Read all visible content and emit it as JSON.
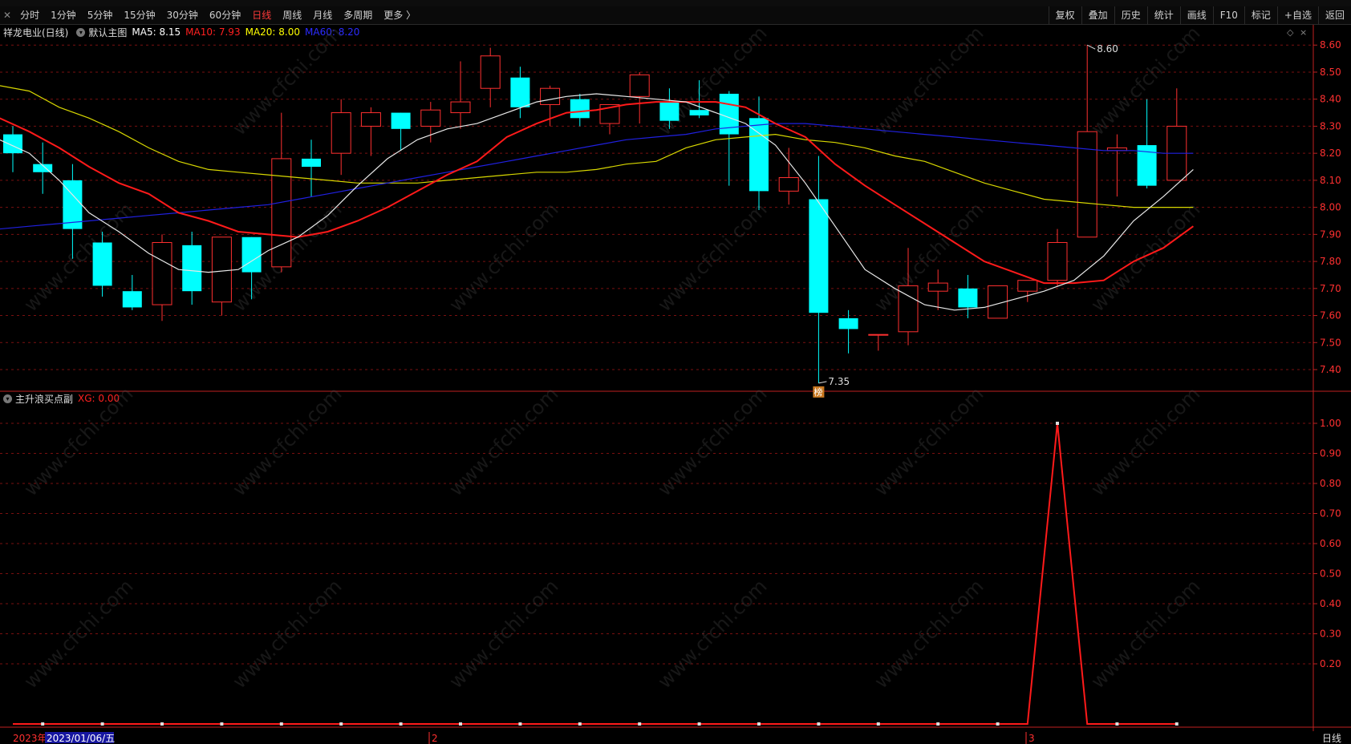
{
  "toolbar": {
    "periods": [
      "分时",
      "1分钟",
      "5分钟",
      "15分钟",
      "30分钟",
      "60分钟",
      "日线",
      "周线",
      "月线",
      "多周期",
      "更多 〉"
    ],
    "active_period": "日线",
    "right_buttons": [
      "复权",
      "叠加",
      "历史",
      "统计",
      "画线",
      "F10",
      "标记",
      "+自选",
      "返回"
    ]
  },
  "main_panel": {
    "stock": "祥龙电业(日线)",
    "template": "默认主图",
    "ma": [
      {
        "label": "MA5: 8.15",
        "color": "#ffffff"
      },
      {
        "label": "MA10: 7.93",
        "color": "#ff2020"
      },
      {
        "label": "MA20: 8.00",
        "color": "#ffff00"
      },
      {
        "label": "MA60: 8.20",
        "color": "#2b2bff"
      }
    ],
    "y_ticks": [
      "8.60",
      "8.50",
      "8.40",
      "8.30",
      "8.20",
      "8.10",
      "8.00",
      "7.90",
      "7.80",
      "7.70",
      "7.60",
      "7.50",
      "7.40"
    ],
    "high_label": "8.60",
    "low_label": "7.35",
    "badge": "榜"
  },
  "sub_panel": {
    "indicator": "主升浪买点副",
    "xg_label": "XG: 0.00",
    "y_ticks": [
      "1.00",
      "0.90",
      "0.80",
      "0.70",
      "0.60",
      "0.50",
      "0.40",
      "0.30",
      "0.20"
    ]
  },
  "bottom": {
    "year": "2023年",
    "date": "2023/01/06/五",
    "month_marks": [
      "2",
      "3"
    ],
    "period_label": "日线"
  },
  "watermark": "www.cfchi.com",
  "colors": {
    "up": "#ff3030",
    "down": "#00ffff",
    "grid": "#7a1010",
    "axis": "#c02020"
  },
  "chart_data": {
    "type": "candlestick",
    "candles": [
      {
        "o": 8.27,
        "h": 8.3,
        "l": 8.13,
        "c": 8.2
      },
      {
        "o": 8.16,
        "h": 8.24,
        "l": 8.05,
        "c": 8.13
      },
      {
        "o": 8.1,
        "h": 8.16,
        "l": 7.81,
        "c": 7.92
      },
      {
        "o": 7.87,
        "h": 7.91,
        "l": 7.67,
        "c": 7.71
      },
      {
        "o": 7.69,
        "h": 7.75,
        "l": 7.62,
        "c": 7.63
      },
      {
        "o": 7.64,
        "h": 7.9,
        "l": 7.58,
        "c": 7.87
      },
      {
        "o": 7.86,
        "h": 7.91,
        "l": 7.64,
        "c": 7.69
      },
      {
        "o": 7.65,
        "h": 7.89,
        "l": 7.6,
        "c": 7.89
      },
      {
        "o": 7.89,
        "h": 7.89,
        "l": 7.66,
        "c": 7.76
      },
      {
        "o": 7.78,
        "h": 8.35,
        "l": 7.76,
        "c": 8.18
      },
      {
        "o": 8.18,
        "h": 8.25,
        "l": 8.04,
        "c": 8.15
      },
      {
        "o": 8.2,
        "h": 8.4,
        "l": 8.12,
        "c": 8.35
      },
      {
        "o": 8.3,
        "h": 8.37,
        "l": 8.19,
        "c": 8.35
      },
      {
        "o": 8.35,
        "h": 8.35,
        "l": 8.21,
        "c": 8.29
      },
      {
        "o": 8.3,
        "h": 8.39,
        "l": 8.24,
        "c": 8.36
      },
      {
        "o": 8.35,
        "h": 8.54,
        "l": 8.29,
        "c": 8.39
      },
      {
        "o": 8.44,
        "h": 8.59,
        "l": 8.37,
        "c": 8.56
      },
      {
        "o": 8.48,
        "h": 8.52,
        "l": 8.33,
        "c": 8.37
      },
      {
        "o": 8.38,
        "h": 8.45,
        "l": 8.3,
        "c": 8.44
      },
      {
        "o": 8.4,
        "h": 8.42,
        "l": 8.3,
        "c": 8.33
      },
      {
        "o": 8.31,
        "h": 8.38,
        "l": 8.27,
        "c": 8.38
      },
      {
        "o": 8.41,
        "h": 8.5,
        "l": 8.31,
        "c": 8.49
      },
      {
        "o": 8.39,
        "h": 8.44,
        "l": 8.29,
        "c": 8.32
      },
      {
        "o": 8.36,
        "h": 8.47,
        "l": 8.33,
        "c": 8.34
      },
      {
        "o": 8.42,
        "h": 8.43,
        "l": 8.08,
        "c": 8.27
      },
      {
        "o": 8.33,
        "h": 8.41,
        "l": 7.99,
        "c": 8.06
      },
      {
        "o": 8.06,
        "h": 8.22,
        "l": 8.01,
        "c": 8.11
      },
      {
        "o": 8.03,
        "h": 8.19,
        "l": 7.35,
        "c": 7.61
      },
      {
        "o": 7.59,
        "h": 7.62,
        "l": 7.46,
        "c": 7.55
      },
      {
        "o": 7.53,
        "h": 7.53,
        "l": 7.47,
        "c": 7.53
      },
      {
        "o": 7.54,
        "h": 7.85,
        "l": 7.49,
        "c": 7.71
      },
      {
        "o": 7.69,
        "h": 7.77,
        "l": 7.62,
        "c": 7.72
      },
      {
        "o": 7.7,
        "h": 7.75,
        "l": 7.59,
        "c": 7.63
      },
      {
        "o": 7.59,
        "h": 7.71,
        "l": 7.59,
        "c": 7.71
      },
      {
        "o": 7.69,
        "h": 7.73,
        "l": 7.65,
        "c": 7.73
      },
      {
        "o": 7.73,
        "h": 7.92,
        "l": 7.71,
        "c": 7.87
      },
      {
        "o": 7.89,
        "h": 8.6,
        "l": 7.89,
        "c": 8.28
      },
      {
        "o": 8.21,
        "h": 8.27,
        "l": 8.04,
        "c": 8.22
      },
      {
        "o": 8.23,
        "h": 8.4,
        "l": 8.07,
        "c": 8.08
      },
      {
        "o": 8.1,
        "h": 8.44,
        "l": 8.1,
        "c": 8.3
      }
    ],
    "ma5": [
      8.25,
      8.2,
      8.1,
      7.98,
      7.91,
      7.83,
      7.77,
      7.76,
      7.77,
      7.84,
      7.89,
      7.97,
      8.08,
      8.18,
      8.25,
      8.29,
      8.31,
      8.35,
      8.39,
      8.41,
      8.42,
      8.41,
      8.4,
      8.39,
      8.35,
      8.31,
      8.23,
      8.09,
      7.93,
      7.77,
      7.7,
      7.64,
      7.62,
      7.63,
      7.66,
      7.69,
      7.73,
      7.82,
      7.95,
      8.04,
      8.14
    ],
    "ma10": [
      8.33,
      8.28,
      8.22,
      8.15,
      8.09,
      8.05,
      7.98,
      7.95,
      7.91,
      7.9,
      7.89,
      7.91,
      7.95,
      8.0,
      8.06,
      8.12,
      8.17,
      8.26,
      8.31,
      8.35,
      8.36,
      8.38,
      8.39,
      8.39,
      8.39,
      8.37,
      8.31,
      8.26,
      8.16,
      8.08,
      8.01,
      7.94,
      7.87,
      7.8,
      7.76,
      7.72,
      7.72,
      7.73,
      7.8,
      7.85,
      7.93
    ],
    "ma20": [
      8.45,
      8.43,
      8.37,
      8.33,
      8.28,
      8.22,
      8.17,
      8.14,
      8.13,
      8.12,
      8.11,
      8.1,
      8.09,
      8.09,
      8.09,
      8.1,
      8.11,
      8.12,
      8.13,
      8.13,
      8.14,
      8.16,
      8.17,
      8.22,
      8.25,
      8.26,
      8.27,
      8.25,
      8.24,
      8.22,
      8.19,
      8.17,
      8.13,
      8.09,
      8.06,
      8.03,
      8.02,
      8.01,
      8.0,
      8.0,
      8.0
    ],
    "ma60": [
      7.92,
      7.93,
      7.94,
      7.95,
      7.96,
      7.97,
      7.98,
      7.99,
      8.0,
      8.01,
      8.03,
      8.05,
      8.07,
      8.09,
      8.11,
      8.13,
      8.15,
      8.17,
      8.19,
      8.21,
      8.23,
      8.25,
      8.26,
      8.27,
      8.29,
      8.3,
      8.31,
      8.31,
      8.3,
      8.29,
      8.28,
      8.27,
      8.26,
      8.25,
      8.24,
      8.23,
      8.22,
      8.21,
      8.21,
      8.2,
      8.2
    ],
    "xg": [
      0,
      0,
      0,
      0,
      0,
      0,
      0,
      0,
      0,
      0,
      0,
      0,
      0,
      0,
      0,
      0,
      0,
      0,
      0,
      0,
      0,
      0,
      0,
      0,
      0,
      0,
      0,
      0,
      0,
      0,
      0,
      0,
      0,
      0,
      0,
      1,
      0,
      0,
      0,
      0
    ]
  }
}
